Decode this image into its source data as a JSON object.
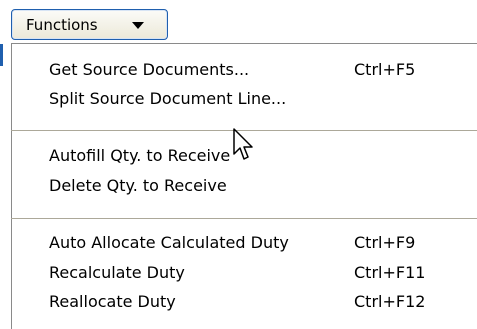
{
  "functions_button": {
    "label": "Functions",
    "icon": "chevron-down-icon"
  },
  "menu": {
    "items": [
      {
        "label": "Get Source Documents...",
        "shortcut": "Ctrl+F5"
      },
      {
        "label": "Split Source Document Line...",
        "shortcut": ""
      },
      {
        "label": "Autofill Qty. to Receive",
        "shortcut": ""
      },
      {
        "label": "Delete Qty. to Receive",
        "shortcut": ""
      },
      {
        "label": "Auto Allocate Calculated Duty",
        "shortcut": "Ctrl+F9"
      },
      {
        "label": "Recalculate Duty",
        "shortcut": "Ctrl+F11"
      },
      {
        "label": "Reallocate Duty",
        "shortcut": "Ctrl+F12"
      }
    ]
  },
  "cursor": {
    "icon": "mouse-pointer-icon"
  },
  "colors": {
    "button_border": "#1f5fae",
    "separator": "#aca899",
    "background": "#ffffff"
  }
}
